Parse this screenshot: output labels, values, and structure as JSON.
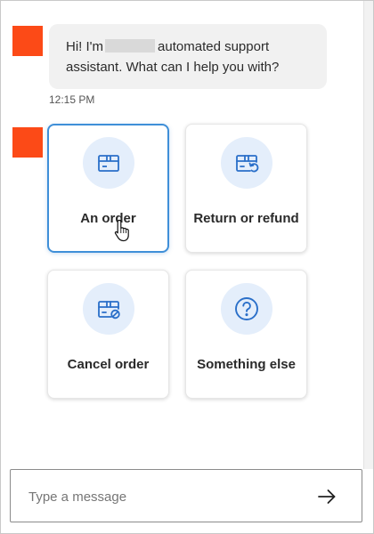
{
  "conversation": {
    "bot_message": {
      "greeting": "Hi! I'm",
      "rest": "automated support assistant. What can I help you with?",
      "time": "12:15 PM"
    },
    "options": [
      {
        "label": "An order",
        "icon": "box-icon",
        "selected": true
      },
      {
        "label": "Return or refund",
        "icon": "box-return-icon",
        "selected": false
      },
      {
        "label": "Cancel order",
        "icon": "box-cancel-icon",
        "selected": false
      },
      {
        "label": "Something else",
        "icon": "question-icon",
        "selected": false
      }
    ]
  },
  "composer": {
    "placeholder": "Type a message",
    "send_icon": "arrow-right-icon"
  },
  "colors": {
    "avatar": "#fc4a17",
    "bubble": "#f1f1f1",
    "icon_circle": "#e4eefb",
    "icon_stroke": "#2a6fc9",
    "selected_border": "#3f8fd8"
  }
}
